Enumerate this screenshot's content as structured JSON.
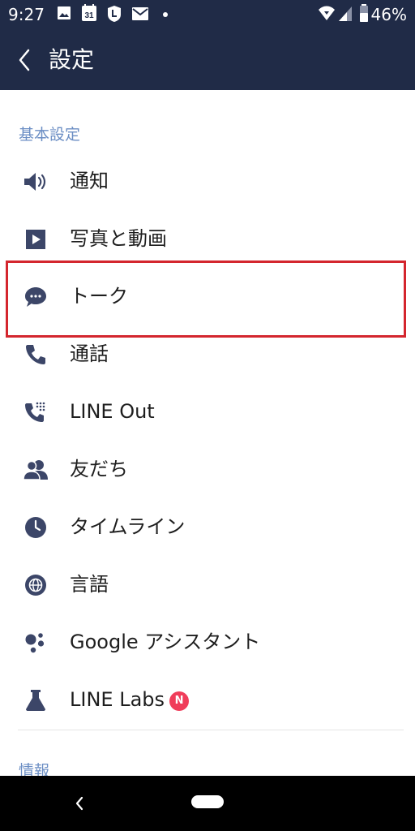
{
  "status_bar": {
    "time": "9:27",
    "calendar_day": "31",
    "battery_percent": "46%",
    "icons": [
      "image-icon",
      "calendar-icon",
      "line-notification-icon",
      "mail-icon",
      "dot-icon",
      "wifi-icon",
      "signal-icon",
      "battery-icon"
    ]
  },
  "header": {
    "title": "設定",
    "background_color": "#202b47"
  },
  "sections": {
    "basic": {
      "header": "基本設定",
      "items": [
        {
          "label": "通知",
          "icon": "speaker-icon"
        },
        {
          "label": "写真と動画",
          "icon": "play-icon"
        },
        {
          "label": "トーク",
          "icon": "chat-bubble-icon",
          "highlighted": true
        },
        {
          "label": "通話",
          "icon": "phone-icon"
        },
        {
          "label": "LINE Out",
          "icon": "phone-dialpad-icon"
        },
        {
          "label": "友だち",
          "icon": "people-icon"
        },
        {
          "label": "タイムライン",
          "icon": "clock-icon"
        },
        {
          "label": "言語",
          "icon": "globe-icon"
        },
        {
          "label": "Google アシスタント",
          "icon": "google-assistant-icon"
        },
        {
          "label": "LINE Labs",
          "icon": "flask-icon",
          "badge": "N"
        }
      ]
    },
    "info": {
      "header": "情報"
    }
  },
  "colors": {
    "accent_section": "#6b8ec4",
    "icon": "#3c4668",
    "highlight": "#d4262e",
    "badge": "#f03d5a"
  }
}
